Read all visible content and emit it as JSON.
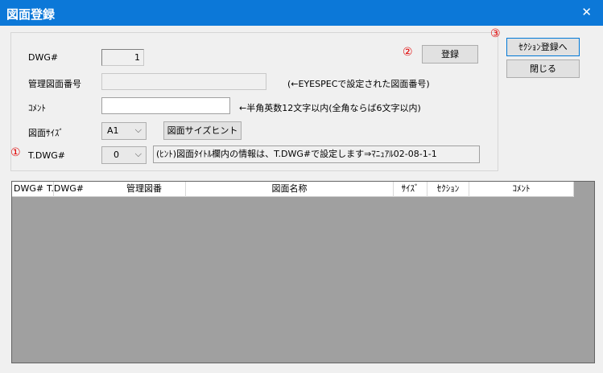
{
  "window": {
    "title": "図面登録",
    "close_glyph": "✕"
  },
  "form": {
    "dwg_label": "DWG#",
    "dwg_value": "1",
    "mgmt_label": "管理図面番号",
    "mgmt_value": "",
    "mgmt_note": "(←EYESPECで設定された図面番号)",
    "comment_label": "ｺﾒﾝﾄ",
    "comment_value": "",
    "comment_note": "←半角英数12文字以内(全角ならば6文字以内)",
    "size_label": "図面ｻｲｽﾞ",
    "size_value": "A1",
    "size_hint_button": "図面サイズヒント",
    "tdwg_label": "T.DWG#",
    "tdwg_value": "0",
    "hint_text": "(ﾋﾝﾄ)図面ﾀｲﾄﾙ欄内の情報は、T.DWG#で設定します⇒ﾏﾆｭｱﾙ02-08-1-1"
  },
  "buttons": {
    "register": "登録",
    "section_register": "ｾｸｼｮﾝ登録へ",
    "close": "閉じる"
  },
  "markers": {
    "one": "①",
    "two": "②",
    "three": "③"
  },
  "list": {
    "columns": [
      "DWG#",
      "T.DWG#",
      "管理図番",
      "図面名称",
      "ｻｲｽﾞ",
      "ｾｸｼｮﾝ",
      "ｺﾒﾝﾄ"
    ]
  },
  "colors": {
    "titlebar": "#0c78d8",
    "marker": "#e00000",
    "list_bg": "#a0a0a0"
  }
}
